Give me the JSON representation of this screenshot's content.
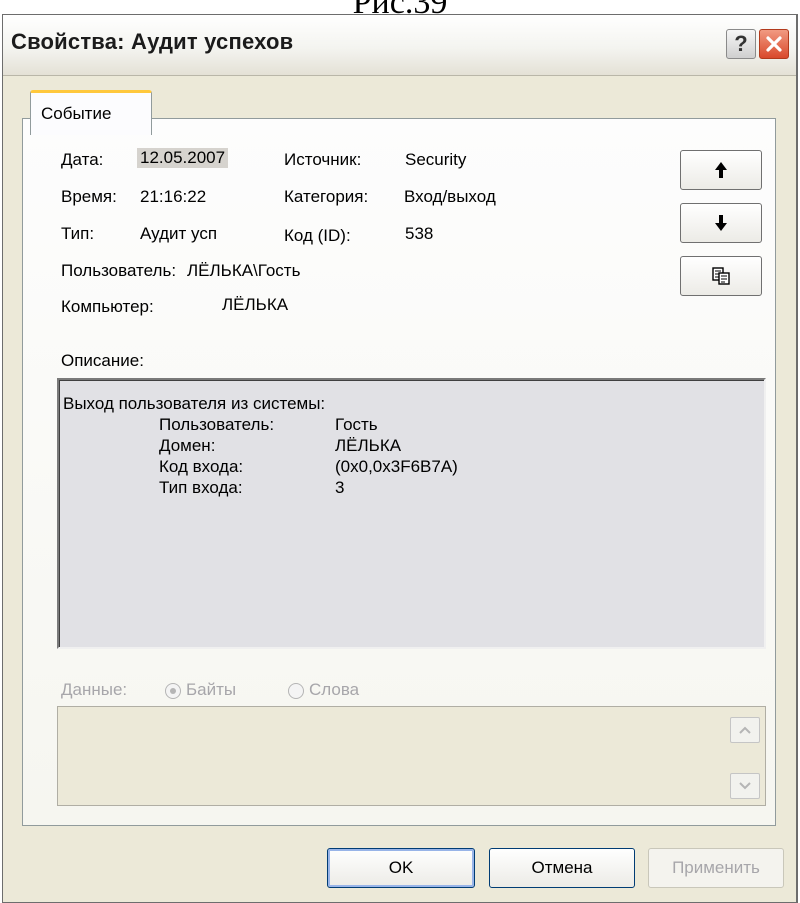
{
  "caption": "Рис.39",
  "window": {
    "title": "Свойства: Аудит успехов",
    "help_glyph": "?",
    "close_icon": "close-x-icon"
  },
  "tab": {
    "label": "Событие"
  },
  "fields": {
    "date_label": "Дата:",
    "date_value": "12.05.2007",
    "time_label": "Время:",
    "time_value": "21:16:22",
    "type_label": "Тип:",
    "type_value": "Аудит усп",
    "source_label": "Источник:",
    "source_value": "Security",
    "category_label": "Категория:",
    "category_value": "Вход/выход",
    "id_label": "Код (ID):",
    "id_value": "538",
    "user_label": "Пользователь:",
    "user_value": "ЛЁЛЬКА\\Гость",
    "computer_label": "Компьютер:",
    "computer_value": "ЛЁЛЬКА"
  },
  "side_buttons": [
    "arrow-up-icon",
    "arrow-down-icon",
    "copy-icon"
  ],
  "description": {
    "label": "Описание:",
    "heading": "Выход пользователя из системы:",
    "rows": [
      {
        "key": "Пользователь:",
        "value": "Гость"
      },
      {
        "key": "Домен:",
        "value": "ЛЁЛЬКА"
      },
      {
        "key": "Код входа:",
        "value": "(0x0,0x3F6B7A)"
      },
      {
        "key": "Тип входа:",
        "value": "3"
      }
    ]
  },
  "data_section": {
    "label": "Данные:",
    "option_bytes": "Байты",
    "option_words": "Слова",
    "selected": "Байты"
  },
  "buttons": {
    "ok": "OK",
    "cancel": "Отмена",
    "apply": "Применить"
  },
  "colors": {
    "dialog_bg": "#ece9d8",
    "tab_highlight": "#ffc83c",
    "close_button": "#d9492b",
    "description_bg": "#e1e1e5"
  }
}
